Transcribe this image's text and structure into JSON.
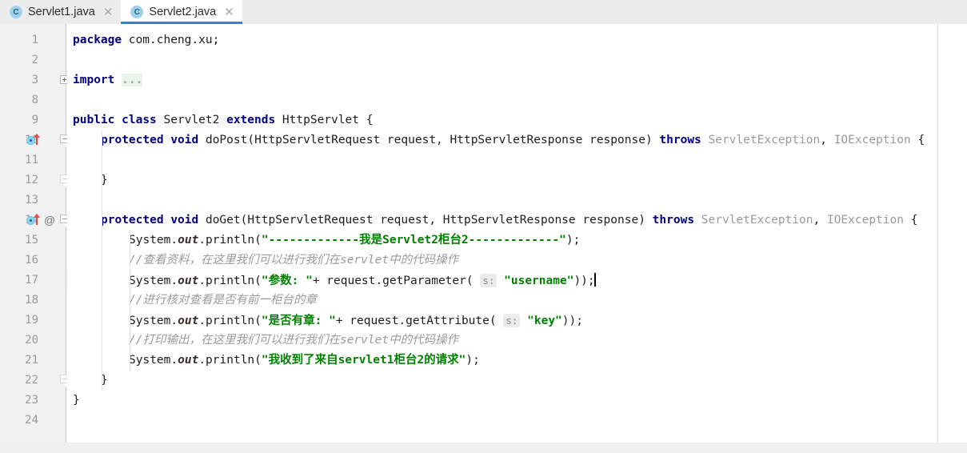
{
  "window": {
    "app": "IntelliJ IDEA Java Editor",
    "colors": {
      "accent": "#2f81d4",
      "keyword": "#000080",
      "string": "#008000",
      "comment": "#9a9a9a",
      "gutter_bg": "#f1f1f1",
      "current_line_highlight": "#fdf8e3",
      "folded_bg": "#e9f5e9",
      "override_marker": "#8ed3ef",
      "override_arrow": "#e04a4a"
    }
  },
  "tabs": [
    {
      "label": "Servlet1.java",
      "icon": "java-class-icon",
      "icon_letter": "C",
      "close_icon": "close-icon",
      "active": false
    },
    {
      "label": "Servlet2.java",
      "icon": "java-class-icon",
      "icon_letter": "C",
      "close_icon": "close-icon",
      "active": true
    }
  ],
  "editor": {
    "current_line": 17,
    "caret_line": 17,
    "right_margin_column_x": 1172,
    "lines": [
      {
        "num": "1",
        "indent": 0,
        "gutter": [],
        "fold": null,
        "tokens": [
          {
            "t": "kw",
            "v": "package"
          },
          {
            "t": "plain",
            "v": " com.cheng.xu;"
          }
        ]
      },
      {
        "num": "2",
        "indent": 0,
        "gutter": [],
        "fold": null,
        "tokens": []
      },
      {
        "num": "3",
        "indent": 0,
        "gutter": [],
        "fold": "plus",
        "tokens": [
          {
            "t": "kw",
            "v": "import"
          },
          {
            "t": "plain",
            "v": " "
          },
          {
            "t": "fld",
            "v": "..."
          }
        ]
      },
      {
        "num": "8",
        "indent": 0,
        "gutter": [],
        "fold": null,
        "tokens": []
      },
      {
        "num": "9",
        "indent": 0,
        "gutter": [],
        "fold": null,
        "tokens": [
          {
            "t": "kw",
            "v": "public"
          },
          {
            "t": "plain",
            "v": " "
          },
          {
            "t": "kw",
            "v": "class"
          },
          {
            "t": "plain",
            "v": " Servlet2 "
          },
          {
            "t": "kw",
            "v": "extends"
          },
          {
            "t": "plain",
            "v": " HttpServlet {"
          }
        ]
      },
      {
        "num": "10",
        "indent": 1,
        "gutter": [
          "override"
        ],
        "fold": "shield",
        "tokens": [
          {
            "t": "kw",
            "v": "protected"
          },
          {
            "t": "plain",
            "v": " "
          },
          {
            "t": "kw",
            "v": "void"
          },
          {
            "t": "plain",
            "v": " doPost(HttpServletRequest request, HttpServletResponse response) "
          },
          {
            "t": "kw",
            "v": "throws"
          },
          {
            "t": "plain",
            "v": " "
          },
          {
            "t": "gry",
            "v": "ServletException"
          },
          {
            "t": "plain",
            "v": ", "
          },
          {
            "t": "gry",
            "v": "IOException"
          },
          {
            "t": "plain",
            "v": " {"
          }
        ]
      },
      {
        "num": "11",
        "indent": 0,
        "gutter": [],
        "fold": null,
        "tokens": []
      },
      {
        "num": "12",
        "indent": 1,
        "gutter": [],
        "fold": "shield-dim",
        "tokens": [
          {
            "t": "plain",
            "v": "}"
          }
        ]
      },
      {
        "num": "13",
        "indent": 0,
        "gutter": [],
        "fold": null,
        "tokens": []
      },
      {
        "num": "14",
        "indent": 1,
        "gutter": [
          "override",
          "annotation"
        ],
        "fold": "shield",
        "tokens": [
          {
            "t": "kw",
            "v": "protected"
          },
          {
            "t": "plain",
            "v": " "
          },
          {
            "t": "kw",
            "v": "void"
          },
          {
            "t": "plain",
            "v": " doGet(HttpServletRequest request, HttpServletResponse response) "
          },
          {
            "t": "kw",
            "v": "throws"
          },
          {
            "t": "plain",
            "v": " "
          },
          {
            "t": "gry",
            "v": "ServletException"
          },
          {
            "t": "plain",
            "v": ", "
          },
          {
            "t": "gry",
            "v": "IOException"
          },
          {
            "t": "plain",
            "v": " {"
          }
        ]
      },
      {
        "num": "15",
        "indent": 2,
        "gutter": [],
        "fold": null,
        "tokens": [
          {
            "t": "plain",
            "v": "System."
          },
          {
            "t": "stat",
            "v": "out"
          },
          {
            "t": "plain",
            "v": ".println("
          },
          {
            "t": "str",
            "v": "\"-------------我是Servlet2柜台2-------------\""
          },
          {
            "t": "plain",
            "v": ");"
          }
        ]
      },
      {
        "num": "16",
        "indent": 2,
        "gutter": [],
        "fold": null,
        "tokens": [
          {
            "t": "cmt",
            "v": "//查看资料，在这里我们可以进行我们在servlet中的代码操作"
          }
        ]
      },
      {
        "num": "17",
        "indent": 2,
        "gutter": [],
        "fold": null,
        "highlight": true,
        "caret": true,
        "tokens": [
          {
            "t": "plain",
            "v": "System."
          },
          {
            "t": "stat",
            "v": "out"
          },
          {
            "t": "plain",
            "v": ".println("
          },
          {
            "t": "str",
            "v": "\"参数: \""
          },
          {
            "t": "plain",
            "v": "+ request.getParameter( "
          },
          {
            "t": "hint",
            "v": "s:"
          },
          {
            "t": "plain",
            "v": " "
          },
          {
            "t": "str",
            "v": "\"username\""
          },
          {
            "t": "plain",
            "v": "));"
          }
        ]
      },
      {
        "num": "18",
        "indent": 2,
        "gutter": [],
        "fold": null,
        "tokens": [
          {
            "t": "cmt",
            "v": "//进行核对查看是否有前一柜台的章"
          }
        ]
      },
      {
        "num": "19",
        "indent": 2,
        "gutter": [],
        "fold": null,
        "tokens": [
          {
            "t": "plain",
            "v": "System."
          },
          {
            "t": "stat",
            "v": "out"
          },
          {
            "t": "plain",
            "v": ".println("
          },
          {
            "t": "str",
            "v": "\"是否有章: \""
          },
          {
            "t": "plain",
            "v": "+ request.getAttribute( "
          },
          {
            "t": "hint",
            "v": "s:"
          },
          {
            "t": "plain",
            "v": " "
          },
          {
            "t": "str",
            "v": "\"key\""
          },
          {
            "t": "plain",
            "v": "));"
          }
        ]
      },
      {
        "num": "20",
        "indent": 2,
        "gutter": [],
        "fold": null,
        "tokens": [
          {
            "t": "cmt",
            "v": "//打印输出，在这里我们可以进行我们在servlet中的代码操作"
          }
        ]
      },
      {
        "num": "21",
        "indent": 2,
        "gutter": [],
        "fold": null,
        "tokens": [
          {
            "t": "plain",
            "v": "System."
          },
          {
            "t": "stat",
            "v": "out"
          },
          {
            "t": "plain",
            "v": ".println("
          },
          {
            "t": "str",
            "v": "\"我收到了来自servlet1柜台2的请求\""
          },
          {
            "t": "plain",
            "v": ");"
          }
        ]
      },
      {
        "num": "22",
        "indent": 1,
        "gutter": [],
        "fold": "shield-dim",
        "tokens": [
          {
            "t": "plain",
            "v": "}"
          }
        ]
      },
      {
        "num": "23",
        "indent": 0,
        "gutter": [],
        "fold": null,
        "tokens": [
          {
            "t": "plain",
            "v": "}"
          }
        ]
      },
      {
        "num": "24",
        "indent": 0,
        "gutter": [],
        "fold": null,
        "tokens": []
      }
    ]
  }
}
